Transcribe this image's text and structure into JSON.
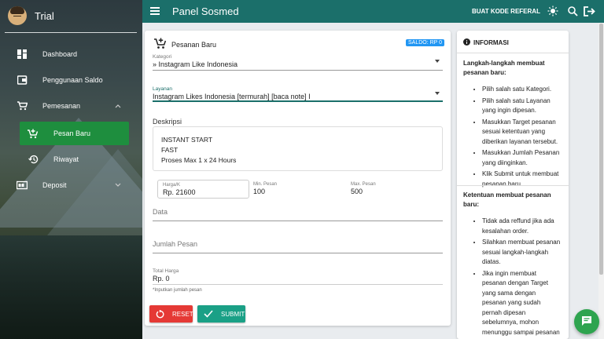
{
  "sidebar": {
    "brand_title": "Trial",
    "items": [
      {
        "label": "Dashboard",
        "icon": "dashboard-icon"
      },
      {
        "label": "Penggunaan Saldo",
        "icon": "wallet-icon"
      },
      {
        "label": "Pemesanan",
        "icon": "cart-icon",
        "expanded": true
      },
      {
        "label": "Pesan Baru",
        "icon": "add-cart-icon",
        "active": true
      },
      {
        "label": "Riwayat",
        "icon": "history-icon"
      },
      {
        "label": "Deposit",
        "icon": "deposit-icon",
        "expanded": false
      }
    ]
  },
  "topbar": {
    "title": "Panel Sosmed",
    "referral_label": "BUAT KODE REFERAL",
    "icons": [
      "theme-toggle-icon",
      "search-icon",
      "logout-icon"
    ]
  },
  "order_form": {
    "header_label": "Pesanan Baru",
    "saldo_badge": "SALDO: RP 0",
    "kategori_label": "Kategori",
    "kategori_value": "» Instagram Like Indonesia",
    "layanan_label": "Layanan",
    "layanan_value": "Instagram Likes Indonesia [termurah] [baca note] I",
    "deskripsi_label": "Deskripsi",
    "deskripsi_lines": [
      "INSTANT START",
      "FAST",
      "Proses Max 1 x 24 Hours"
    ],
    "harga_label": "Harga/K",
    "harga_value": "Rp. 21600",
    "min_label": "Min. Pesan",
    "min_value": "100",
    "max_label": "Max. Pesan",
    "max_value": "500",
    "data_placeholder": "Data",
    "jumlah_placeholder": "Jumlah Pesan",
    "total_label": "Total Harga",
    "total_value": "Rp. 0",
    "hint": "*Inputkan jumlah pesan",
    "reset_label": "RESET",
    "submit_label": "SUBMIT"
  },
  "info": {
    "title": "INFORMASI",
    "section1_title": "Langkah-langkah membuat pesanan baru:",
    "section1_items": [
      "Pilih salah satu Kategori.",
      "Pilih salah satu Layanan yang ingin dipesan.",
      "Masukkan Target pesanan sesuai ketentuan yang diberikan layanan tersebut.",
      "Masukkan Jumlah Pesanan yang diinginkan.",
      "Klik Submit untuk membuat pesanan baru."
    ],
    "section2_title": "Ketentuan membuat pesanan baru:",
    "section2_items": [
      "Tidak ada reffund jika ada kesalahan order.",
      "Silahkan membuat pesanan sesuai langkah-langkah diatas.",
      "Jika ingin membuat pesanan dengan Target yang sama dengan pesanan yang sudah pernah dipesan sebelumnya, mohon menunggu sampai pesanan sebelumnya"
    ]
  },
  "colors": {
    "topbar": "#1b6f6a",
    "active_nav": "#1e8e3e",
    "saldo_badge": "#2196f3",
    "reset": "#e53935",
    "submit": "#1aa086",
    "fab": "#2ea44f"
  }
}
